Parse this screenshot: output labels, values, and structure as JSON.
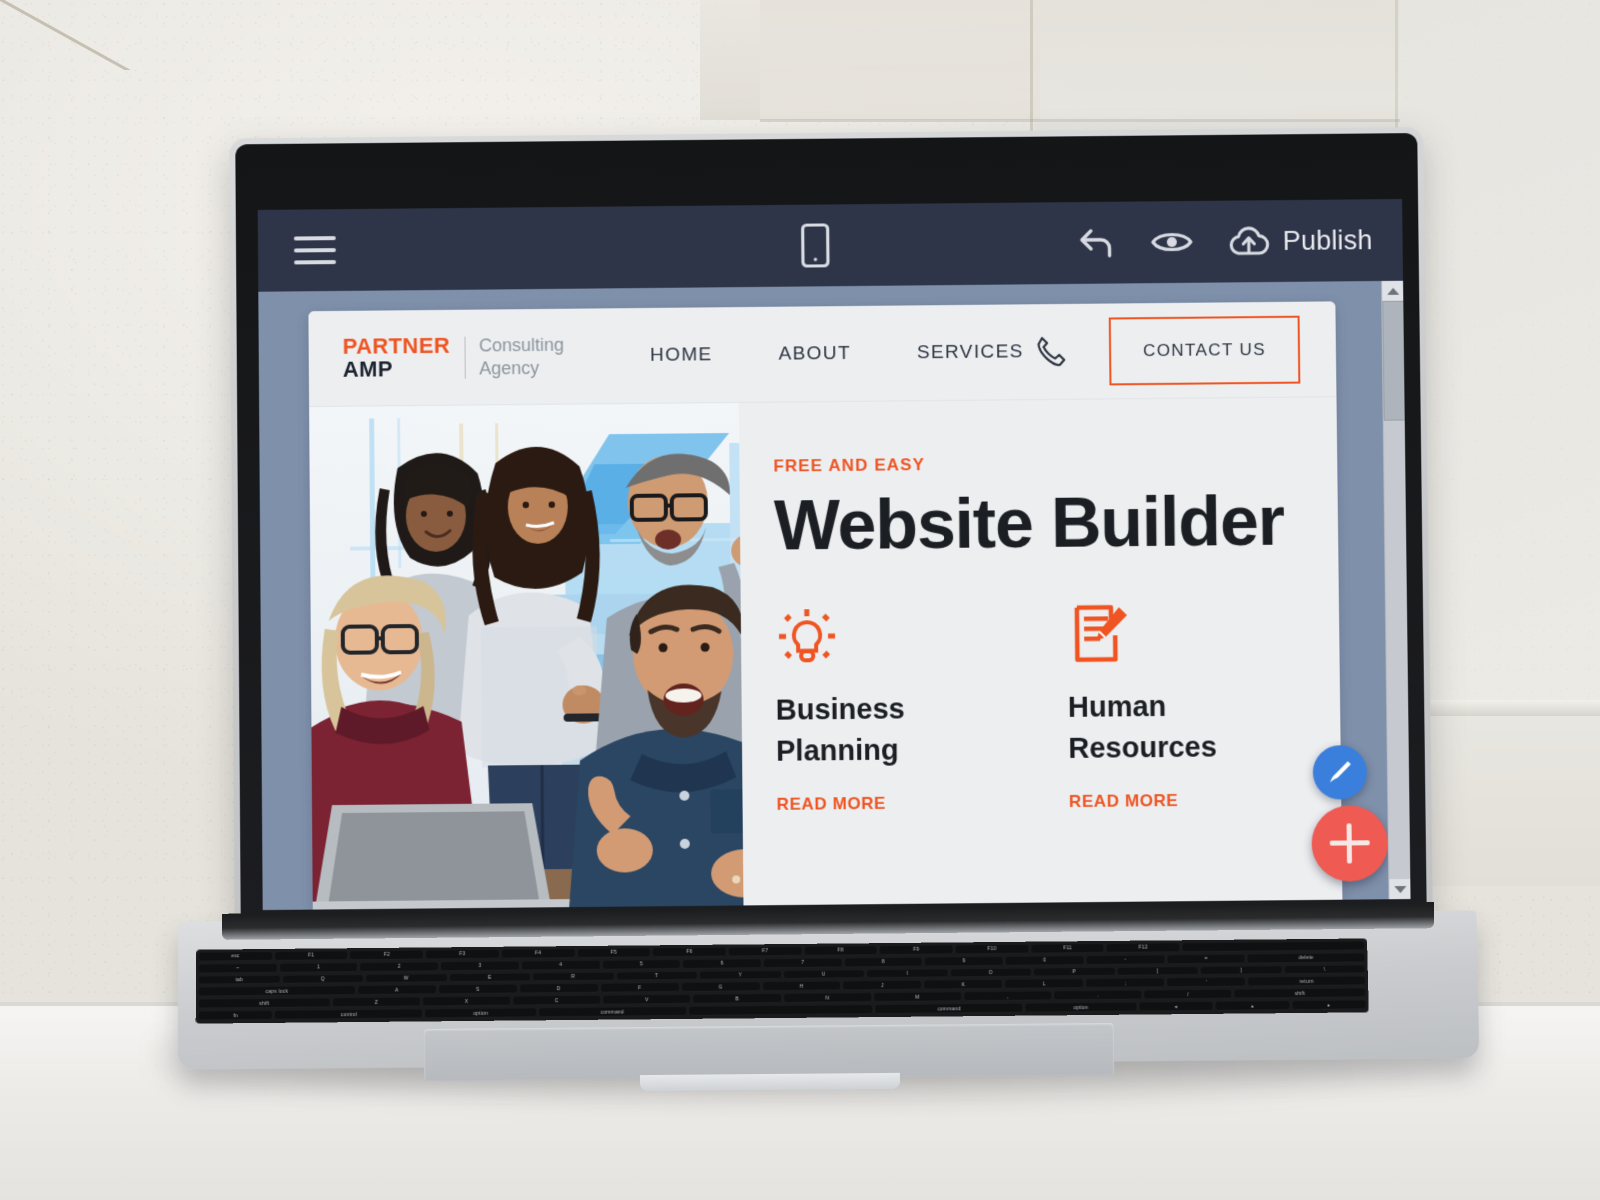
{
  "app": {
    "toolbar": {
      "menu_icon": "hamburger-menu-icon",
      "device_icon": "mobile-device-icon",
      "undo_icon": "undo-arrow-icon",
      "preview_icon": "eye-preview-icon",
      "publish_icon": "cloud-upload-icon",
      "publish_label": "Publish",
      "background_color": "#2e3548"
    },
    "canvas": {
      "background_color": "#7f90ab"
    },
    "scrollbar": {
      "up_arrow": "scroll-up-arrow-icon",
      "down_arrow": "scroll-down-arrow-icon"
    },
    "fabs": {
      "brush_icon": "paint-brush-icon",
      "brush_color": "#3b7fdd",
      "add_icon": "plus-icon",
      "add_color": "#ef5a52"
    }
  },
  "site": {
    "logo": {
      "primary": "PARTNER",
      "secondary": "AMP",
      "tagline_line1": "Consulting",
      "tagline_line2": "Agency",
      "primary_color": "#ef5422"
    },
    "nav": [
      {
        "label": "HOME"
      },
      {
        "label": "ABOUT"
      },
      {
        "label": "SERVICES"
      }
    ],
    "phone_icon": "phone-handset-icon",
    "contact_button": "CONTACT US",
    "hero": {
      "eyebrow": "FREE AND EASY",
      "title": "Website Builder",
      "accent_color": "#ef5422",
      "photo_alt": "team-celebrating-around-laptop"
    },
    "features": [
      {
        "icon": "lightbulb-idea-icon",
        "title_line1": "Business",
        "title_line2": "Planning",
        "link": "READ MORE"
      },
      {
        "icon": "document-edit-icon",
        "title_line1": "Human",
        "title_line2": "Resources",
        "link": "READ MORE"
      }
    ]
  },
  "keyboard": {
    "row1": [
      "esc",
      "F1",
      "F2",
      "F3",
      "F4",
      "F5",
      "F6",
      "F7",
      "F8",
      "F9",
      "F10",
      "F11",
      "F12",
      ""
    ],
    "row2": [
      "~",
      "1",
      "2",
      "3",
      "4",
      "5",
      "6",
      "7",
      "8",
      "9",
      "0",
      "-",
      "=",
      "delete"
    ],
    "row3": [
      "tab",
      "Q",
      "W",
      "E",
      "R",
      "T",
      "Y",
      "U",
      "I",
      "O",
      "P",
      "[",
      "]",
      "\\"
    ],
    "row4": [
      "caps lock",
      "A",
      "S",
      "D",
      "F",
      "G",
      "H",
      "J",
      "K",
      "L",
      ";",
      "'",
      "return"
    ],
    "row5": [
      "shift",
      "Z",
      "X",
      "C",
      "V",
      "B",
      "N",
      "M",
      ",",
      ".",
      "/",
      "shift"
    ],
    "row6": [
      "fn",
      "control",
      "option",
      "command",
      "",
      "command",
      "option",
      "◂",
      "▴",
      "▸"
    ]
  }
}
